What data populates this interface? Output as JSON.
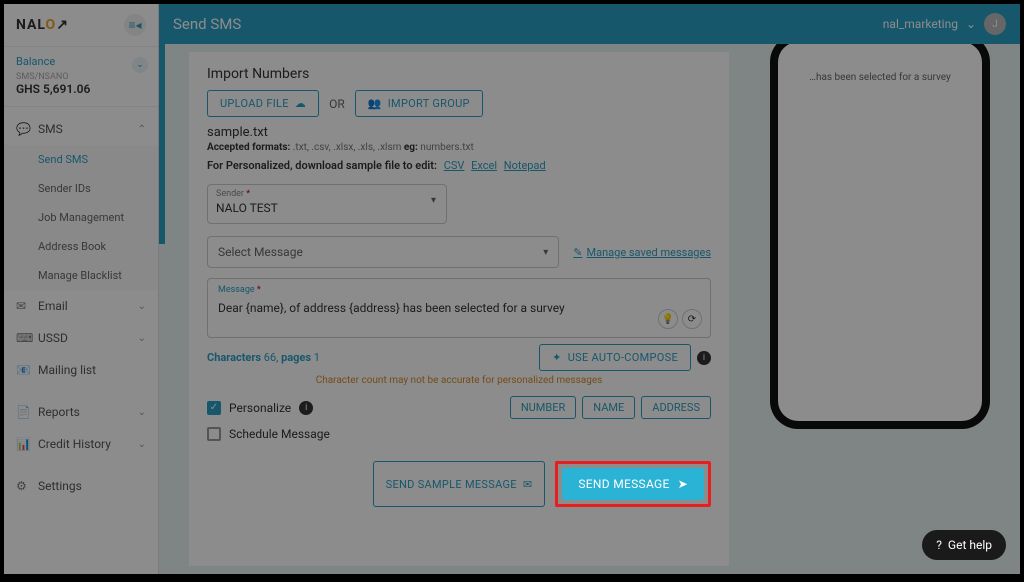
{
  "logo_text": "NALO",
  "balance": {
    "label": "Balance",
    "sublabel": "SMS/NSANO",
    "amount": "GHS 5,691.06"
  },
  "nav": {
    "sms": {
      "label": "SMS",
      "expanded": true,
      "items": [
        "Send SMS",
        "Sender IDs",
        "Job Management",
        "Address Book",
        "Manage Blacklist"
      ],
      "active_index": 0
    },
    "email": "Email",
    "ussd": "USSD",
    "mailing": "Mailing list",
    "reports": "Reports",
    "credit": "Credit History",
    "settings": "Settings"
  },
  "header": {
    "title": "Send SMS",
    "user": "nal_marketing",
    "avatar_initial": "J"
  },
  "form": {
    "import_title": "Import Numbers",
    "upload_btn": "UPLOAD FILE",
    "or": "OR",
    "import_group_btn": "IMPORT GROUP",
    "filename": "sample.txt",
    "accepted_prefix": "Accepted formats:",
    "accepted_formats": ".txt, .csv, .xlsx, .xls, .xlsm",
    "accepted_eg_label": "eg:",
    "accepted_eg": "numbers.txt",
    "personalized_prefix": "For Personalized, download sample file to edit:",
    "dl_csv": "CSV",
    "dl_excel": "Excel",
    "dl_notepad": "Notepad",
    "sender_label": "Sender",
    "sender_value": "NALO TEST",
    "select_msg_placeholder": "Select Message",
    "manage_saved": "Manage saved messages",
    "message_label": "Message",
    "message_value": "Dear  {name}, of address  {address} has been selected for a survey",
    "chars_label": "Characters",
    "chars_count": "66",
    "pages_label": "pages",
    "pages_count": "1",
    "auto_compose_btn": "USE AUTO-COMPOSE",
    "warning": "Character count may not be accurate for personalized messages",
    "personalize_label": "Personalize",
    "var_number": "NUMBER",
    "var_name": "NAME",
    "var_address": "ADDRESS",
    "schedule_label": "Schedule Message",
    "send_sample_btn": "SEND SAMPLE MESSAGE",
    "send_btn": "SEND MESSAGE"
  },
  "phone_preview_msg": "…has been selected for a survey",
  "get_help": "Get help"
}
